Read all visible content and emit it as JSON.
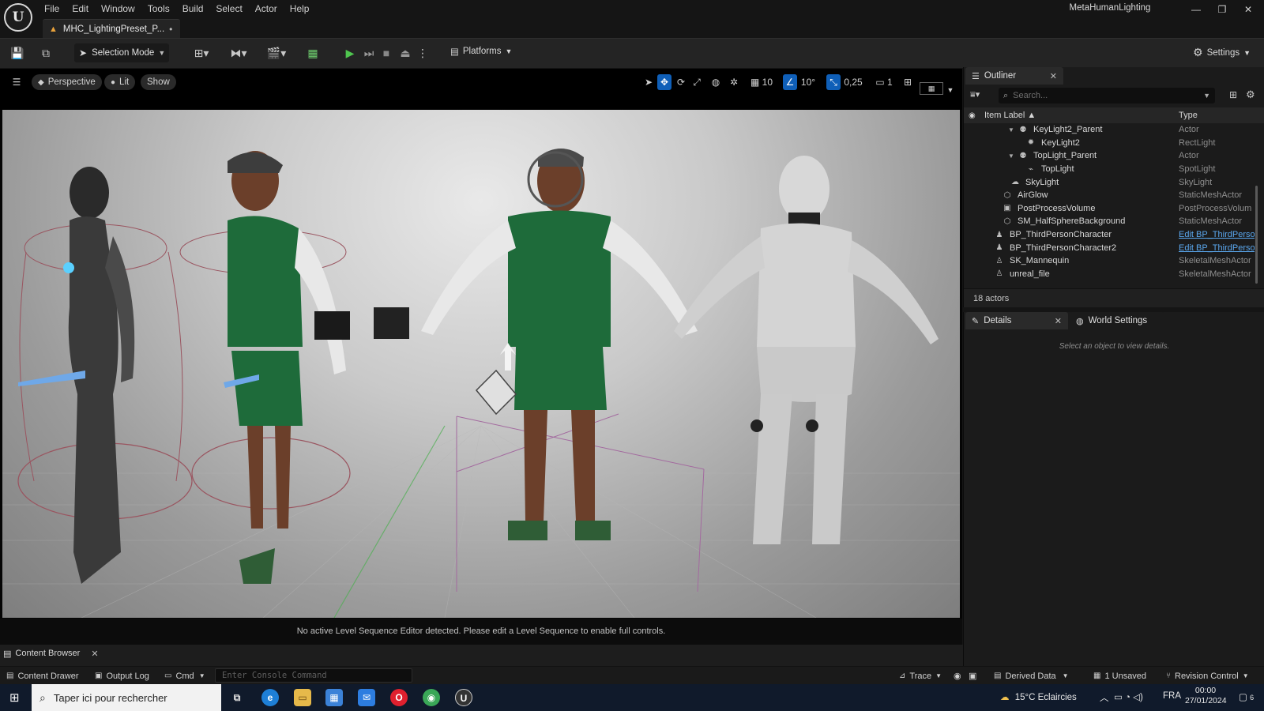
{
  "app": {
    "logo": "U",
    "title": "MetaHumanLighting",
    "document_tab": "MHC_LightingPreset_P...",
    "unsaved_dot": "•",
    "minimize": "—",
    "restore": "❐",
    "close": "✕"
  },
  "menu": [
    "File",
    "Edit",
    "Window",
    "Tools",
    "Build",
    "Select",
    "Actor",
    "Help"
  ],
  "toolbar": {
    "selection_mode": "Selection Mode",
    "platforms": "Platforms",
    "settings": "Settings"
  },
  "viewport": {
    "perspective": "Perspective",
    "lit": "Lit",
    "show": "Show",
    "grid_snap": "10",
    "rotation_snap": "10°",
    "scale_snap": "0,25",
    "camera_speed": "1",
    "message": "No active Level Sequence Editor detected. Please edit a Level Sequence to enable full controls."
  },
  "outliner": {
    "tab_label": "Outliner",
    "search_placeholder": "Search...",
    "col_label": "Item Label ▲",
    "col_type": "Type",
    "rows": [
      {
        "label": "KeyLight2_Parent",
        "type": "Actor",
        "indent": 3,
        "twisty": "▼",
        "icon": "⚉",
        "link": false
      },
      {
        "label": "KeyLight2",
        "type": "RectLight",
        "indent": 4,
        "twisty": "",
        "icon": "✹",
        "link": false
      },
      {
        "label": "TopLight_Parent",
        "type": "Actor",
        "indent": 3,
        "twisty": "▼",
        "icon": "⚉",
        "link": false
      },
      {
        "label": "TopLight",
        "type": "SpotLight",
        "indent": 4,
        "twisty": "",
        "icon": "⌁",
        "link": false
      },
      {
        "label": "SkyLight",
        "type": "SkyLight",
        "indent": 2,
        "twisty": "",
        "icon": "☁",
        "link": false
      },
      {
        "label": "AirGlow",
        "type": "StaticMeshActor",
        "indent": 1,
        "twisty": "",
        "icon": "⬡",
        "link": false
      },
      {
        "label": "PostProcessVolume",
        "type": "PostProcessVolum",
        "indent": 1,
        "twisty": "",
        "icon": "▣",
        "link": false
      },
      {
        "label": "SM_HalfSphereBackground",
        "type": "StaticMeshActor",
        "indent": 1,
        "twisty": "",
        "icon": "⬡",
        "link": false
      },
      {
        "label": "BP_ThirdPersonCharacter",
        "type": "Edit BP_ThirdPerso",
        "indent": 0,
        "twisty": "",
        "icon": "♟",
        "link": true
      },
      {
        "label": "BP_ThirdPersonCharacter2",
        "type": "Edit BP_ThirdPerso",
        "indent": 0,
        "twisty": "",
        "icon": "♟",
        "link": true
      },
      {
        "label": "SK_Mannequin",
        "type": "SkeletalMeshActor",
        "indent": 0,
        "twisty": "",
        "icon": "♙",
        "link": false
      },
      {
        "label": "unreal_file",
        "type": "SkeletalMeshActor",
        "indent": 0,
        "twisty": "",
        "icon": "♙",
        "link": false
      }
    ],
    "count": "18 actors"
  },
  "details": {
    "tab_label": "Details",
    "world_settings": "World Settings",
    "empty": "Select an object to view details."
  },
  "bottom": {
    "content_browser": "Content Browser",
    "content_drawer": "Content Drawer",
    "output_log": "Output Log",
    "cmd": "Cmd",
    "console_placeholder": "Enter Console Command",
    "trace": "Trace",
    "derived_data": "Derived Data",
    "unsaved": "1 Unsaved",
    "revision_control": "Revision Control"
  },
  "taskbar": {
    "search": "Taper ici pour rechercher",
    "weather": "15°C  Eclaircies",
    "lang": "FRA",
    "time": "00:00",
    "date": "27/01/2024",
    "notifications": "6"
  },
  "colors": {
    "accent": "#0f5fb8",
    "play": "#4fc64f",
    "link": "#5aa7ee",
    "jacket": "#1e6b3a"
  }
}
